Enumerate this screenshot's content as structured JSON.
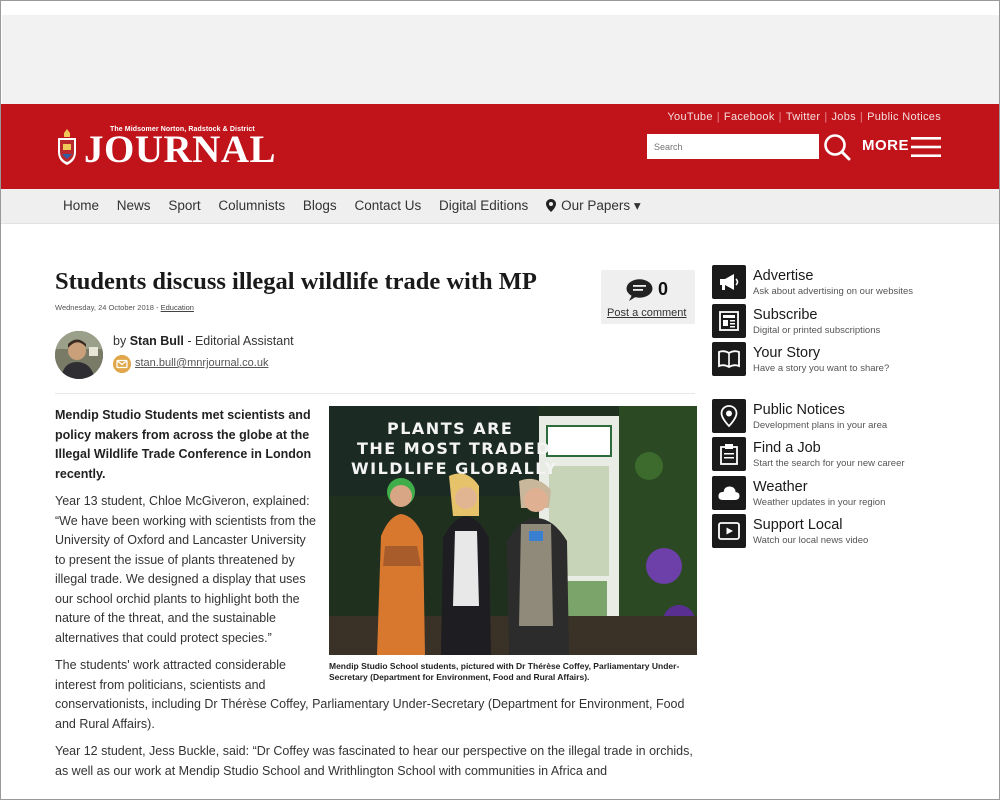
{
  "site": {
    "logo_small": "The Midsomer Norton, Radstock & District",
    "logo_big": "JOURNAL",
    "top_links": [
      "YouTube",
      "Facebook",
      "Twitter",
      "Jobs",
      "Public Notices"
    ],
    "search_placeholder": "Search",
    "more_label": "MORE",
    "accent_color": "#c0131a"
  },
  "nav": {
    "items": [
      "Home",
      "News",
      "Sport",
      "Columnists",
      "Blogs",
      "Contact Us",
      "Digital Editions"
    ],
    "our_papers": "Our Papers ▾"
  },
  "article": {
    "headline": "Students discuss illegal wildlife trade with MP",
    "date": "Wednesday, 24 October 2018 - ",
    "category": "Education",
    "comment_count": "0",
    "comment_link": "Post a comment",
    "byline_prefix": "by ",
    "author": "Stan Bull",
    "author_role": " - Editorial Assistant",
    "email": "stan.bull@mnrjournal.co.uk",
    "photo_text_line1": "PLANTS ARE",
    "photo_text_line2": "THE MOST TRADED",
    "photo_text_line3": "WILDLIFE GLOBALLY",
    "caption": "Mendip Studio School students, pictured with Dr Thérèse Coffey, Parliamentary Under-Secretary (Department for Environment, Food and Rural Affairs).",
    "lead": "Mendip Studio Students met scientists and policy makers from across the globe at the Illegal Wildlife Trade Conference in London recently.",
    "para1": "Year 13 student, Chloe McGiveron, explained: “We have been working with scientists from the University of Oxford and Lancaster University to present the issue of plants threatened by illegal trade. We designed a display that uses our school orchid plants to highlight both the nature of the threat, and the sustainable alternatives that could protect species.”",
    "para2": "The students' work attracted considerable interest from politicians, scientists and conservationists, including Dr Thérèse Coffey, Parliamentary Under-Secretary (Department for Environment, Food and Rural Affairs).",
    "para3": "Year 12 student, Jess Buckle, said: “Dr Coffey was fascinated to hear our perspective on the illegal trade in orchids, as well as our work at Mendip Studio School and Writhlington School with communities in Africa and"
  },
  "sidebar": {
    "group1": [
      {
        "title": "Advertise",
        "sub": "Ask about advertising on our websites",
        "icon": "megaphone-icon"
      },
      {
        "title": "Subscribe",
        "sub": "Digital or printed subscriptions",
        "icon": "newspaper-icon"
      },
      {
        "title": "Your Story",
        "sub": "Have a story you want to share?",
        "icon": "book-icon"
      }
    ],
    "group2": [
      {
        "title": "Public Notices",
        "sub": "Development plans in your area",
        "icon": "location-pin-icon"
      },
      {
        "title": "Find a Job",
        "sub": "Start the search for your new career",
        "icon": "clipboard-icon"
      },
      {
        "title": "Weather",
        "sub": "Weather updates in your region",
        "icon": "cloud-icon"
      },
      {
        "title": "Support Local",
        "sub": "Watch our local news video",
        "icon": "video-icon"
      }
    ]
  }
}
